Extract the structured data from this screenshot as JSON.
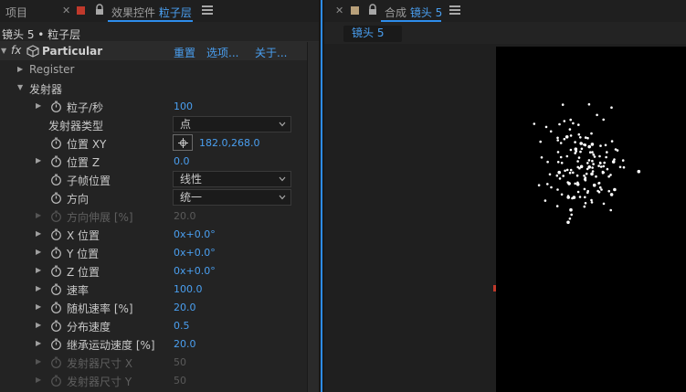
{
  "left_panel": {
    "tab_project": "项目",
    "tab_effect_controls_prefix": "效果控件",
    "tab_effect_controls_layer": "粒子层",
    "subheader": "镜头 5 • 粒子层",
    "effect": {
      "fx_label": "fx",
      "name": "Particular",
      "reset": "重置",
      "options": "选项...",
      "about": "关于..."
    },
    "properties": [
      {
        "key": "register",
        "label": "Register"
      },
      {
        "key": "emitter",
        "label": "发射器"
      },
      {
        "key": "particles_per_sec",
        "label": "粒子/秒",
        "value": "100"
      },
      {
        "key": "emitter_type",
        "label": "发射器类型",
        "value": "点"
      },
      {
        "key": "position_xy",
        "label": "位置 XY",
        "value": "182.0,268.0"
      },
      {
        "key": "position_z",
        "label": "位置 Z",
        "value": "0.0"
      },
      {
        "key": "subframe_position",
        "label": "子帧位置",
        "value": "线性"
      },
      {
        "key": "direction",
        "label": "方向",
        "value": "统一"
      },
      {
        "key": "direction_spread",
        "label": "方向伸展 [%]",
        "value": "20.0"
      },
      {
        "key": "x_rotation",
        "label": "X 位置",
        "value": "0x+0.0°"
      },
      {
        "key": "y_rotation",
        "label": "Y 位置",
        "value": "0x+0.0°"
      },
      {
        "key": "z_rotation",
        "label": "Z 位置",
        "value": "0x+0.0°"
      },
      {
        "key": "velocity",
        "label": "速率",
        "value": "100.0"
      },
      {
        "key": "velocity_random",
        "label": "随机速率 [%]",
        "value": "20.0"
      },
      {
        "key": "velocity_distribution",
        "label": "分布速度",
        "value": "0.5"
      },
      {
        "key": "velocity_from_motion",
        "label": "继承运动速度 [%]",
        "value": "20.0"
      },
      {
        "key": "emitter_size_x",
        "label": "发射器尺寸 X",
        "value": "50"
      },
      {
        "key": "emitter_size_y",
        "label": "发射器尺寸 Y",
        "value": "50"
      }
    ]
  },
  "right_panel": {
    "tab_prefix": "合成",
    "tab_comp_name": "镜头 5",
    "breadcrumb": "镜头 5"
  },
  "colors": {
    "accent": "#2d8ceb",
    "value_blue": "#4a9ff0",
    "effect_controls_swatch": "#c0392b",
    "comp_swatch": "#b8a07a",
    "anchor_point": "#c0392b"
  },
  "icons": [
    "close-icon",
    "lock-icon",
    "menu-icon",
    "stopwatch-icon",
    "plugin-cube-icon",
    "target-icon",
    "chevron-down-icon",
    "triangle-right-icon",
    "triangle-down-icon"
  ]
}
